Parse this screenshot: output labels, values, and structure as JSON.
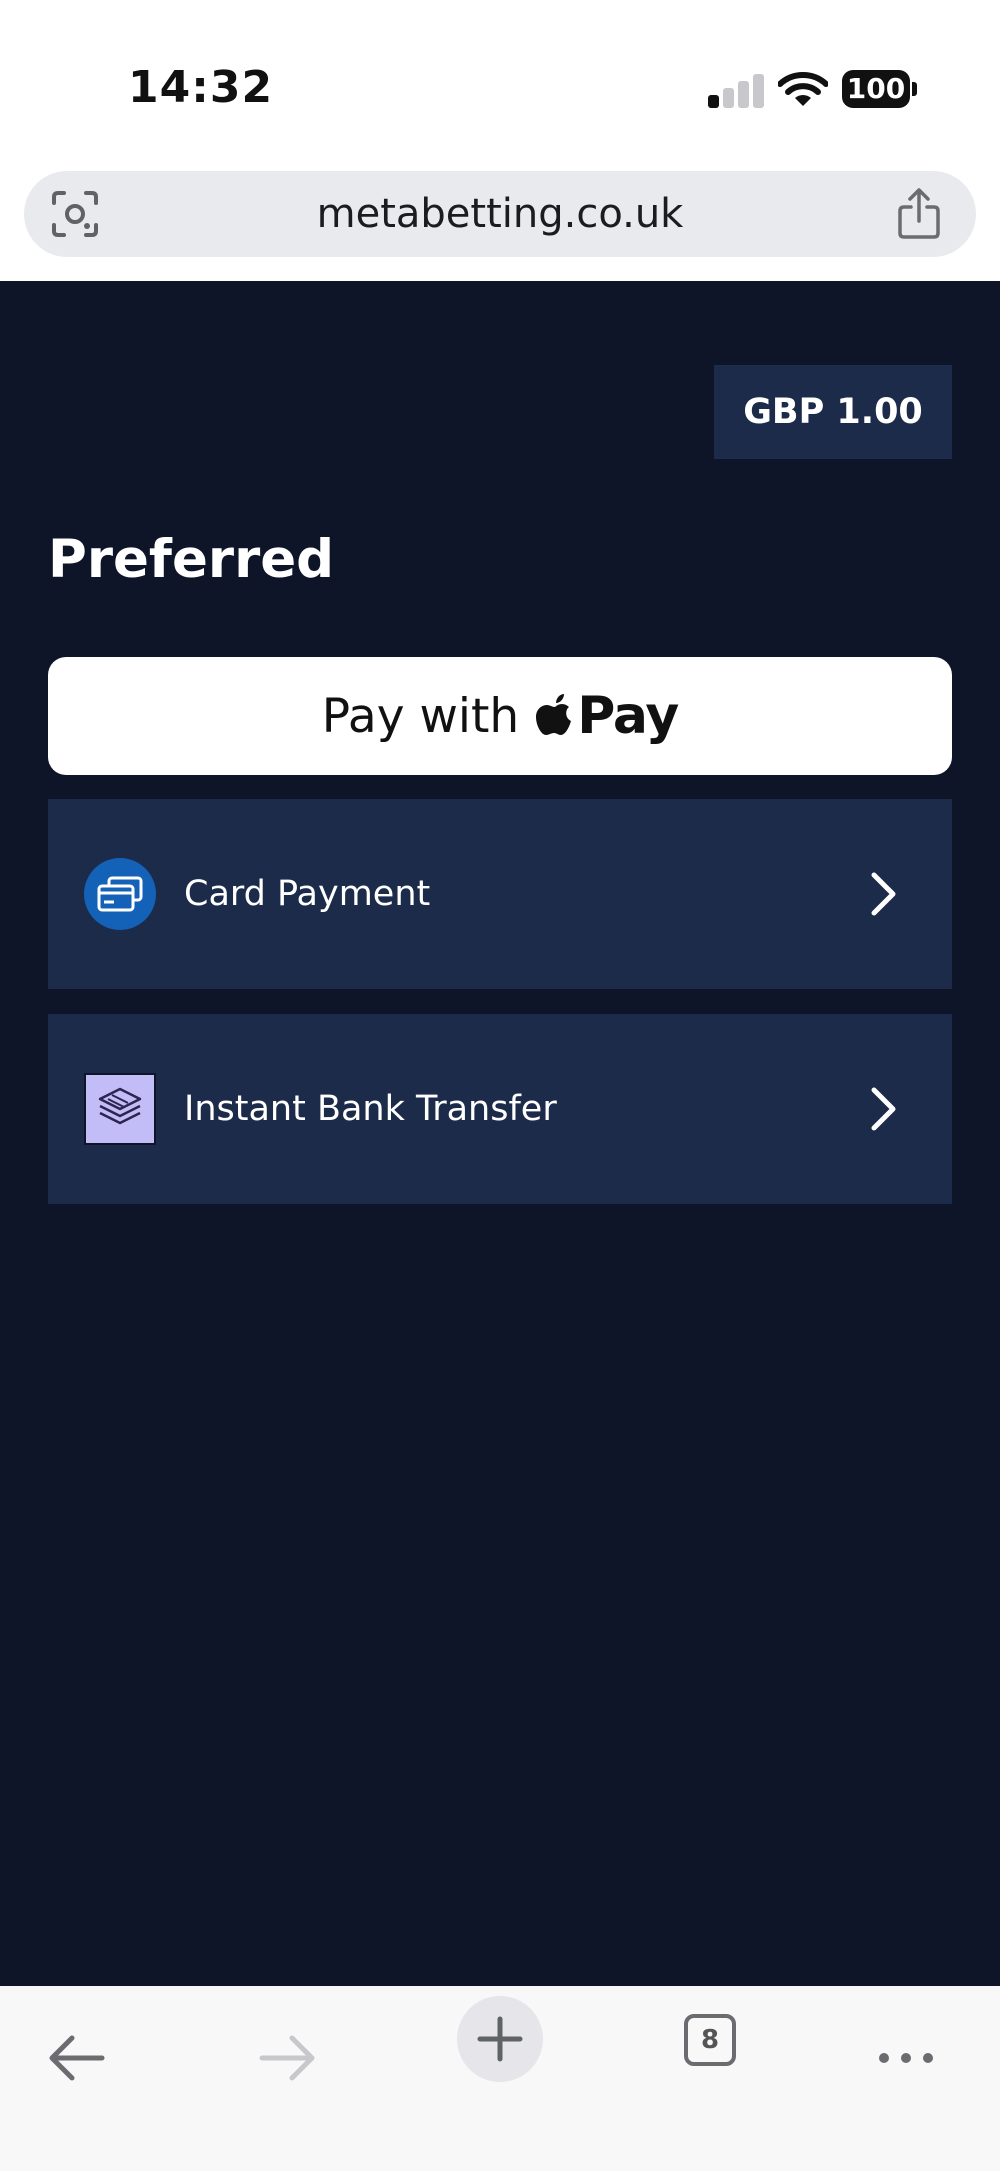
{
  "status_bar": {
    "time": "14:32",
    "battery": "100",
    "icons": [
      "signal-icon",
      "wifi-icon",
      "battery-icon"
    ]
  },
  "browser": {
    "url": "metabetting.co.uk",
    "icons": [
      "lens-icon",
      "share-icon"
    ]
  },
  "payment": {
    "amount": "GBP 1.00",
    "section_title": "Preferred",
    "apple_pay": {
      "prefix": "Pay with",
      "brand": "Pay"
    },
    "methods": [
      {
        "label": "Card Payment",
        "icon": "card-icon"
      },
      {
        "label": "Instant Bank Transfer",
        "icon": "bank-transfer-icon"
      }
    ]
  },
  "toolbar": {
    "tab_count": "8",
    "icons": [
      "back-icon",
      "forward-icon",
      "new-tab-icon",
      "tabs-icon",
      "more-icon"
    ]
  },
  "colors": {
    "background": "#0e1529",
    "panel": "#1c2b4a",
    "card_icon_bg": "#1461b8",
    "bank_icon_bg": "#c3bdf7"
  }
}
